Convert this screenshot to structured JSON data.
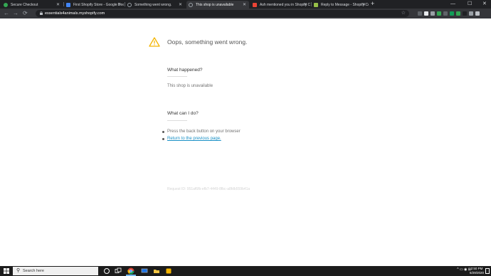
{
  "browser": {
    "tabs": [
      {
        "title": "Secure Checkout",
        "favicon_color": "#34a853"
      },
      {
        "title": "First Shopify Store - Google Docs",
        "favicon_color": "#4285f4"
      },
      {
        "title": "Something went wrong.",
        "favicon_color": "#9aa0a6"
      },
      {
        "title": "This shop is unavailable",
        "favicon_color": "#9aa0a6"
      },
      {
        "title": "Ash mentioned you in Shopify Co",
        "favicon_color": "#ea4335"
      },
      {
        "title": "Reply to Message - Shopify Comm",
        "favicon_color": "#96bf48"
      }
    ],
    "active_tab": 3,
    "new_tab_label": "+",
    "window_controls": {
      "minimize": "—",
      "maximize": "☐",
      "close": "✕"
    },
    "nav": {
      "back": "←",
      "forward": "→",
      "reload": "⟳"
    },
    "url": "essentials4animals.myshopify.com",
    "bookmark_icon": "☆",
    "extension_colors": [
      "#5f6368",
      "#e8eaed",
      "#9aa0a6",
      "#34a853",
      "#5f6368",
      "#0f9d58",
      "#34a853",
      "#202124",
      "#9aa0a6",
      "#bdc1c6"
    ]
  },
  "page": {
    "headline": "Oops, something went wrong.",
    "what_happened_heading": "What happened?",
    "reason": "This shop is unavailable",
    "what_can_i_do_heading": "What can I do?",
    "actions": {
      "press_back": "Press the back button on your browser",
      "return_link": "Return to the previous page."
    },
    "request_id": "Request ID: 951af6fb-efb7-4449-8fbc-a8fdb559b41a",
    "warning_color": "#f4b400"
  },
  "taskbar": {
    "search_placeholder": "Search here",
    "time": "2:50 PM",
    "date": "6/29/2020",
    "tray_icons": "^ ▭ ◉ ⊞"
  }
}
